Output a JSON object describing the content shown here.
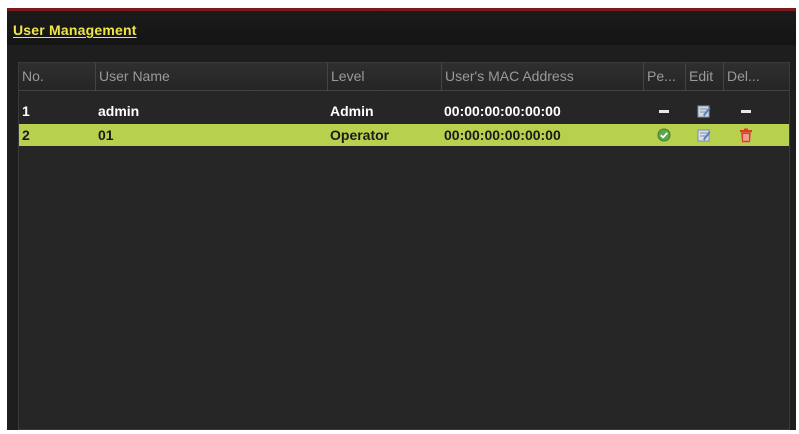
{
  "title": "User Management",
  "columns": [
    "No.",
    "User Name",
    "Level",
    "User's MAC Address",
    "Pe...",
    "Edit",
    "Del..."
  ],
  "rows": [
    {
      "no": "1",
      "user_name": "admin",
      "level": "Admin",
      "mac": "00:00:00:00:00:00",
      "permission_icon": "dash-icon",
      "edit_icon": "edit-icon",
      "delete_icon": "dash-icon"
    },
    {
      "no": "2",
      "user_name": "01",
      "level": "Operator",
      "mac": "00:00:00:00:00:00",
      "permission_icon": "check-icon",
      "edit_icon": "edit-icon",
      "delete_icon": "trash-icon"
    }
  ],
  "selected_row": 2,
  "colors": {
    "title": "#f0e64a",
    "selected_row": "#b7d14e",
    "background": "#1e1e1e",
    "accent_border": "#7a1a1a",
    "delete_icon": "#e03a2a",
    "check_icon": "#5aa84a"
  }
}
